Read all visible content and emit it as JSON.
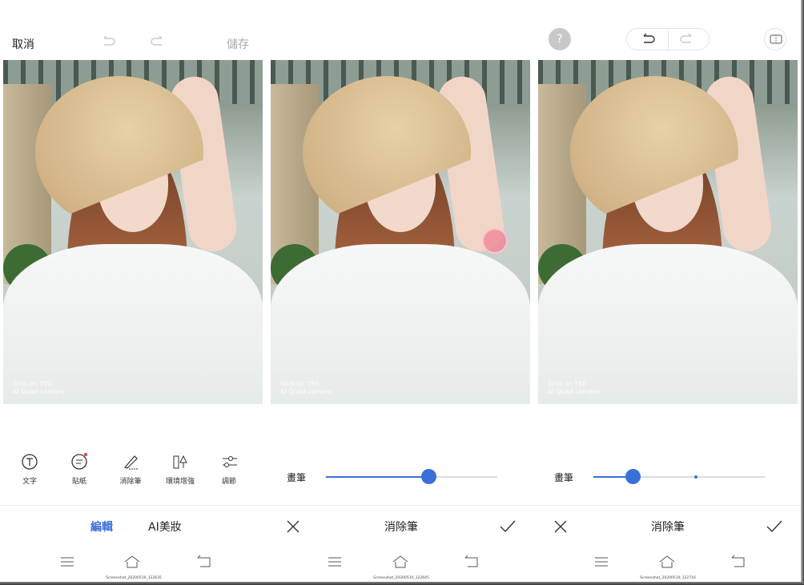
{
  "panel1": {
    "cancel": "取消",
    "save": "儲存",
    "tools": [
      {
        "label": "文字",
        "icon": "text-icon"
      },
      {
        "label": "貼紙",
        "icon": "sticker-icon"
      },
      {
        "label": "消除筆",
        "icon": "eraser-pen-icon"
      },
      {
        "label": "環境增強",
        "icon": "scene-enhance-icon"
      },
      {
        "label": "調節",
        "icon": "adjust-icon"
      }
    ],
    "tabs": [
      "編輯",
      "AI美妝"
    ],
    "caption": "Screenshot_20200510_122635"
  },
  "watermark": {
    "line1": "Shot on Y50",
    "line2": "AI Quad camera"
  },
  "panel2": {
    "slider_label": "畫筆",
    "slider_value": 0.6,
    "title": "消除筆",
    "caption": "Screenshot_20200510_122645"
  },
  "panel3": {
    "help": "?",
    "slider_label": "畫筆",
    "slider_value": 0.23,
    "slider_mark": 0.6,
    "title": "消除筆",
    "caption": "Screenshot_20200510_122716"
  },
  "colors": {
    "accent": "#3b6fd8"
  }
}
